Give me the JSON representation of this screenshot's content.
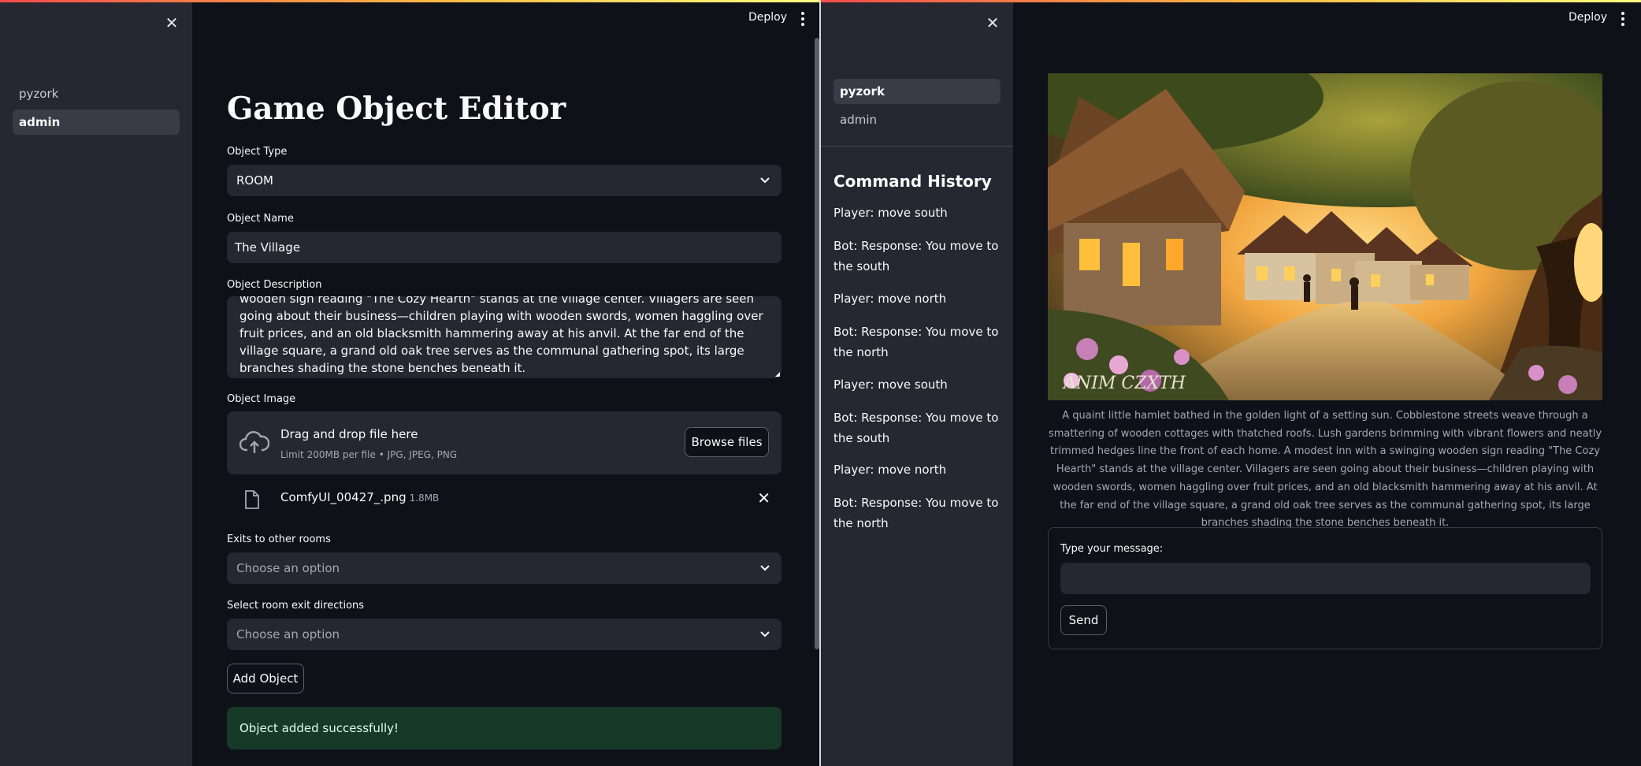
{
  "left_app": {
    "header": {
      "deploy_label": "Deploy"
    },
    "sidebar": {
      "nav": [
        {
          "label": "pyzork",
          "active": false
        },
        {
          "label": "admin",
          "active": true
        }
      ]
    },
    "page_title": "Game Object Editor",
    "form": {
      "object_type": {
        "label": "Object Type",
        "value": "ROOM"
      },
      "object_name": {
        "label": "Object Name",
        "value": "The Village"
      },
      "object_description": {
        "label": "Object Description",
        "value": "and neatly trimmed hedges line the front of each home. A modest inn with a swinging wooden sign reading \"The Cozy Hearth\" stands at the village center. Villagers are seen going about their business—children playing with wooden swords, women haggling over fruit prices, and an old blacksmith hammering away at his anvil. At the far end of the village square, a grand old oak tree serves as the communal gathering spot, its large branches shading the stone benches beneath it."
      },
      "object_image": {
        "label": "Object Image",
        "dropzone_text": "Drag and drop file here",
        "dropzone_limit": "Limit 200MB per file • JPG, JPEG, PNG",
        "browse_label": "Browse files",
        "uploaded_file": {
          "name": "ComfyUI_00427_.png",
          "size": "1.8MB"
        }
      },
      "exits": {
        "label": "Exits to other rooms",
        "placeholder": "Choose an option"
      },
      "exit_directions": {
        "label": "Select room exit directions",
        "placeholder": "Choose an option"
      },
      "submit_label": "Add Object"
    },
    "success_message": "Object added successfully!"
  },
  "right_app": {
    "header": {
      "deploy_label": "Deploy"
    },
    "sidebar": {
      "nav": [
        {
          "label": "pyzork",
          "active": true
        },
        {
          "label": "admin",
          "active": false
        }
      ],
      "history_title": "Command History",
      "history": [
        "Player: move south",
        "Bot: Response: You move to the south",
        "Player: move north",
        "Bot: Response: You move to the north",
        "Player: move south",
        "Bot: Response: You move to the south",
        "Player: move north",
        "Bot: Response: You move to the north"
      ]
    },
    "image": {
      "alt_subject": "village-scene",
      "caption": "A quaint little hamlet bathed in the golden light of a setting sun. Cobblestone streets weave through a smattering of wooden cottages with thatched roofs. Lush gardens brimming with vibrant flowers and neatly trimmed hedges line the front of each home. A modest inn with a swinging wooden sign reading \"The Cozy Hearth\" stands at the village center. Villagers are seen going about their business—children playing with wooden swords, women haggling over fruit prices, and an old blacksmith hammering away at his anvil. At the far end of the village square, a grand old oak tree serves as the communal gathering spot, its large branches shading the stone benches beneath it.",
      "watermark_text": "ANIM CZXTH"
    },
    "chat": {
      "input_label": "Type your message:",
      "input_value": "",
      "send_label": "Send"
    }
  },
  "colors": {
    "background": "#0e1117",
    "sidebar": "#262730",
    "field": "#262730",
    "success_bg": "#173928",
    "accent_red": "#ff4b4b"
  }
}
